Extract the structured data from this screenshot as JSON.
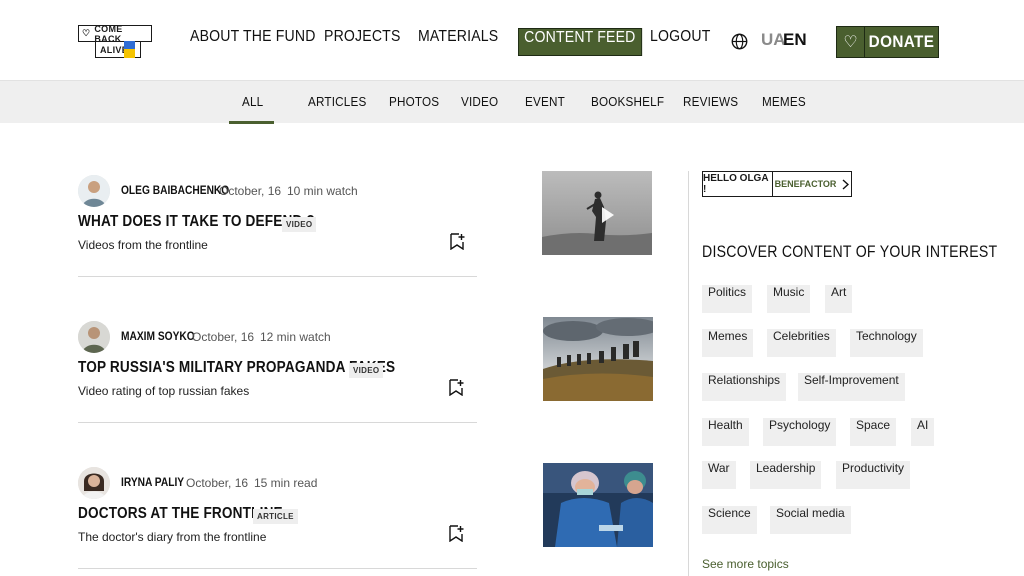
{
  "header": {
    "logo": {
      "line1": "COME BACK",
      "line2": "ALIVE"
    },
    "nav": [
      {
        "label": "About the fund"
      },
      {
        "label": "Projects"
      },
      {
        "label": "Materials"
      },
      {
        "label": "Content feed",
        "active": true
      },
      {
        "label": "Logout"
      }
    ],
    "lang": {
      "ua": "UA",
      "en": "EN",
      "active": "EN"
    },
    "donate_label": "DONATE"
  },
  "categories": {
    "items": [
      "All",
      "Articles",
      "Photos",
      "Video",
      "Event",
      "Bookshelf",
      "Reviews",
      "Memes"
    ],
    "active": "All"
  },
  "posts": [
    {
      "author": "Oleg Baibachenko",
      "date": "October, 16",
      "duration": "10 min watch",
      "title": "What  does it take to defend ?",
      "badge": "VIDEO",
      "description": "Videos from the frontline",
      "thumbnail": "soldier-in-fog-video"
    },
    {
      "author": "Maxim Soyko",
      "date": "October, 16",
      "duration": "12 min watch",
      "title": "Top Russia's military propaganda fakes",
      "badge": "VIDEO",
      "description": "Video rating of top russian fakes",
      "thumbnail": "soldiers-on-ridge"
    },
    {
      "author": "Iryna Paliy",
      "date": "October, 16",
      "duration": "15 min read",
      "title": "Doctors at the frontline",
      "badge": "ARTICLE",
      "description": "The doctor's diary from the frontline",
      "thumbnail": "surgeons-operating"
    }
  ],
  "sidebar": {
    "greeting": "Hello Olga !",
    "role": "Benefactor",
    "discover_title": "Discover content of your interest",
    "topics": [
      "Politics",
      "Music",
      "Art",
      "Memes",
      "Celebrities",
      "Technology",
      "Relationships",
      "Self-Improvement",
      "Health",
      "Psychology",
      "Space",
      "AI",
      "War",
      "Leadership",
      "Productivity",
      "Science",
      "Social media"
    ],
    "see_more": "See more topics"
  },
  "colors": {
    "accent": "#4a5f2f",
    "category_bar": "#efefef",
    "flag_blue": "#2f6dd5",
    "flag_yellow": "#f5c400"
  }
}
